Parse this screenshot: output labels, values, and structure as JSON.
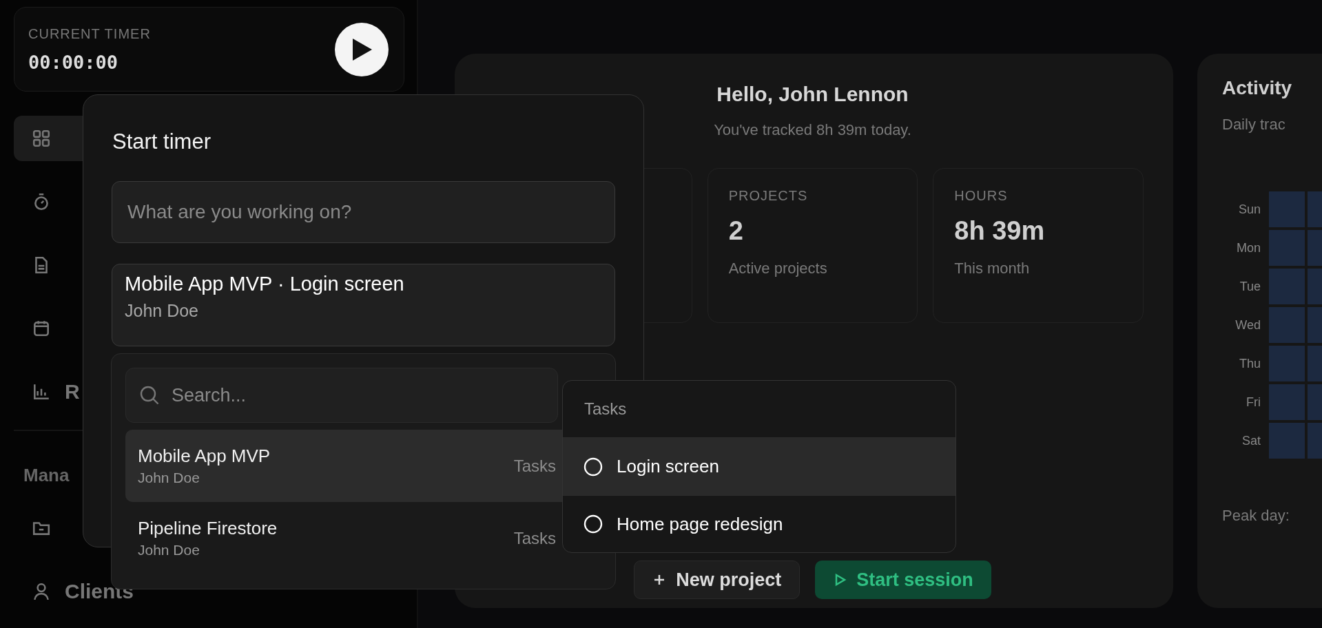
{
  "sidebar": {
    "current_timer": {
      "label": "CURRENT TIMER",
      "time": "00:00:00"
    },
    "nav": [
      {
        "kind": "grid",
        "selected": true
      },
      {
        "kind": "stopwatch",
        "selected": false
      },
      {
        "kind": "document",
        "selected": false
      },
      {
        "kind": "calendar",
        "selected": false
      },
      {
        "kind": "chart",
        "label": "R",
        "selected": false
      }
    ],
    "section_label": "Mana",
    "manage_nav": [
      {
        "kind": "folder",
        "selected": false
      },
      {
        "kind": "user",
        "label": "Clients",
        "selected": false
      }
    ]
  },
  "overview": {
    "greeting": "Hello, John Lennon",
    "subtitle": "You've tracked 8h 39m today.",
    "stats": [
      {
        "label": "PROJECTS",
        "value": "2",
        "note": "Active projects"
      },
      {
        "label": "HOURS",
        "value": "8h 39m",
        "note": "This month"
      }
    ],
    "buttons": [
      {
        "kind": "secondary",
        "label": "New project"
      },
      {
        "kind": "primary",
        "label": "Start session"
      }
    ]
  },
  "activity": {
    "title": "Activity",
    "subtitle": "Daily trac",
    "days": [
      "Sun",
      "Mon",
      "Tue",
      "Wed",
      "Thu",
      "Fri",
      "Sat"
    ],
    "footer": "Peak day:"
  },
  "timer_popover": {
    "title": "Start timer",
    "input": {
      "placeholder": "What are you working on?"
    },
    "selection": {
      "title": "Mobile App MVP · Login screen",
      "subtitle": "John Doe"
    },
    "search": {
      "placeholder": "Search..."
    },
    "projects": [
      {
        "name": "Mobile App MVP",
        "owner": "John Doe",
        "action": "Tasks",
        "selected": true
      },
      {
        "name": "Pipeline Firestore",
        "owner": "John Doe",
        "action": "Tasks",
        "selected": false
      }
    ]
  },
  "tasks_menu": {
    "title": "Tasks",
    "tasks": [
      {
        "name": "Login screen",
        "selected": true,
        "checked": false
      },
      {
        "name": "Home page redesign",
        "selected": false,
        "checked": false
      }
    ]
  }
}
